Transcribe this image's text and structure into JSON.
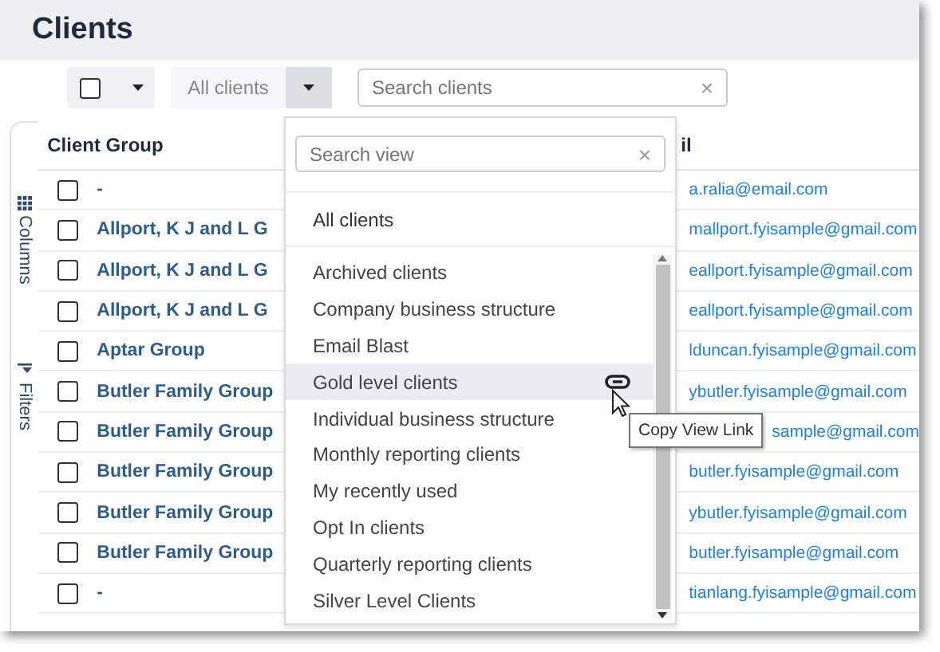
{
  "page": {
    "title": "Clients"
  },
  "toolbar": {
    "select_all_checked": false,
    "view_button": "All clients",
    "view_menu_open": true,
    "search": {
      "placeholder": "Search clients",
      "clear": "×"
    }
  },
  "side_tabs": [
    {
      "label": "Columns",
      "kind": "columns"
    },
    {
      "label": "Filters",
      "kind": "filters"
    }
  ],
  "table": {
    "columns": [
      "Client Group",
      "il"
    ],
    "rows": [
      {
        "checked": false,
        "group": "-",
        "email": "a.ralia@email.com",
        "email_partly_covered": false
      },
      {
        "checked": false,
        "group": "Allport, K J and L G",
        "email": "mallport.fyisample@gmail.com",
        "email_partly_covered": false
      },
      {
        "checked": false,
        "group": "Allport, K J and L G",
        "email": "eallport.fyisample@gmail.com",
        "email_partly_covered": false
      },
      {
        "checked": false,
        "group": "Allport, K J and L G",
        "email": "eallport.fyisample@gmail.com",
        "email_partly_covered": false
      },
      {
        "checked": false,
        "group": "Aptar Group",
        "email": "lduncan.fyisample@gmail.com",
        "email_partly_covered": false
      },
      {
        "checked": false,
        "group": "Butler Family Group",
        "email": "ybutler.fyisample@gmail.com",
        "email_partly_covered": false
      },
      {
        "checked": false,
        "group": "Butler Family Group",
        "email": "sample@gmail.com",
        "email_partly_covered": true
      },
      {
        "checked": false,
        "group": "Butler Family Group",
        "email": "butler.fyisample@gmail.com",
        "email_partly_covered": false
      },
      {
        "checked": false,
        "group": "Butler Family Group",
        "email": "ybutler.fyisample@gmail.com",
        "email_partly_covered": false
      },
      {
        "checked": false,
        "group": "Butler Family Group",
        "email": "butler.fyisample@gmail.com",
        "email_partly_covered": false
      },
      {
        "checked": false,
        "group": "-",
        "email": "tianlang.fyisample@gmail.com",
        "email_partly_covered": false
      }
    ]
  },
  "view_menu": {
    "search": {
      "placeholder": "Search view",
      "clear": "×"
    },
    "default_item": "All clients",
    "items": [
      {
        "label": "Archived clients",
        "highlighted": false
      },
      {
        "label": "Company business structure",
        "highlighted": false
      },
      {
        "label": "Email Blast",
        "highlighted": false
      },
      {
        "label": "Gold level clients",
        "highlighted": true
      },
      {
        "label": "Individual business structure",
        "highlighted": false
      },
      {
        "label": "Monthly reporting clients",
        "highlighted": false
      },
      {
        "label": "My recently used",
        "highlighted": false
      },
      {
        "label": "Opt In clients",
        "highlighted": false
      },
      {
        "label": "Quarterly reporting clients",
        "highlighted": false
      },
      {
        "label": "Silver Level Clients",
        "highlighted": false
      }
    ],
    "tooltip": "Copy View Link"
  }
}
